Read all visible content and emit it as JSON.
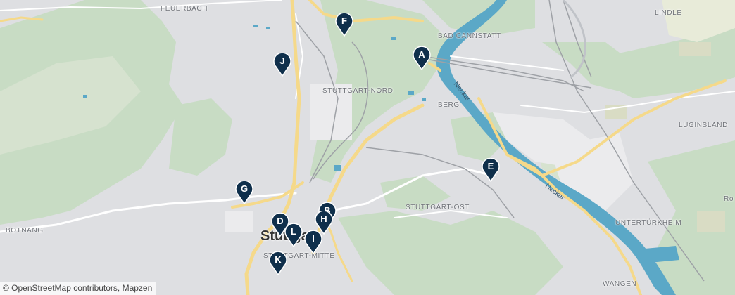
{
  "map": {
    "place_labels": {
      "feuerbach": "FEUERBACH",
      "bad_cannstatt": "BAD CANNSTATT",
      "lindle": "LINDLE",
      "stuttgart_nord": "STUTTGART-NORD",
      "berg": "BERG",
      "luginsland": "LUGINSLAND",
      "stuttgart_ost": "STUTTGART-OST",
      "botnang": "BOTNANG",
      "stuttgart_mitte": "STUTTGART-MITTE",
      "untertuerkheim": "UNTERTÜRKHEIM",
      "wangen": "WANGEN",
      "ro": "Ro",
      "stuttgart": "Stuttgart"
    },
    "river_labels": {
      "neckar_1": "Neckar",
      "neckar_2": "Neckar"
    },
    "markers": [
      "A",
      "B",
      "D",
      "E",
      "F",
      "G",
      "H",
      "I",
      "J",
      "K",
      "L"
    ],
    "marker_color": "#0f2f4b",
    "attribution": "© OpenStreetMap contributors, Mapzen"
  }
}
